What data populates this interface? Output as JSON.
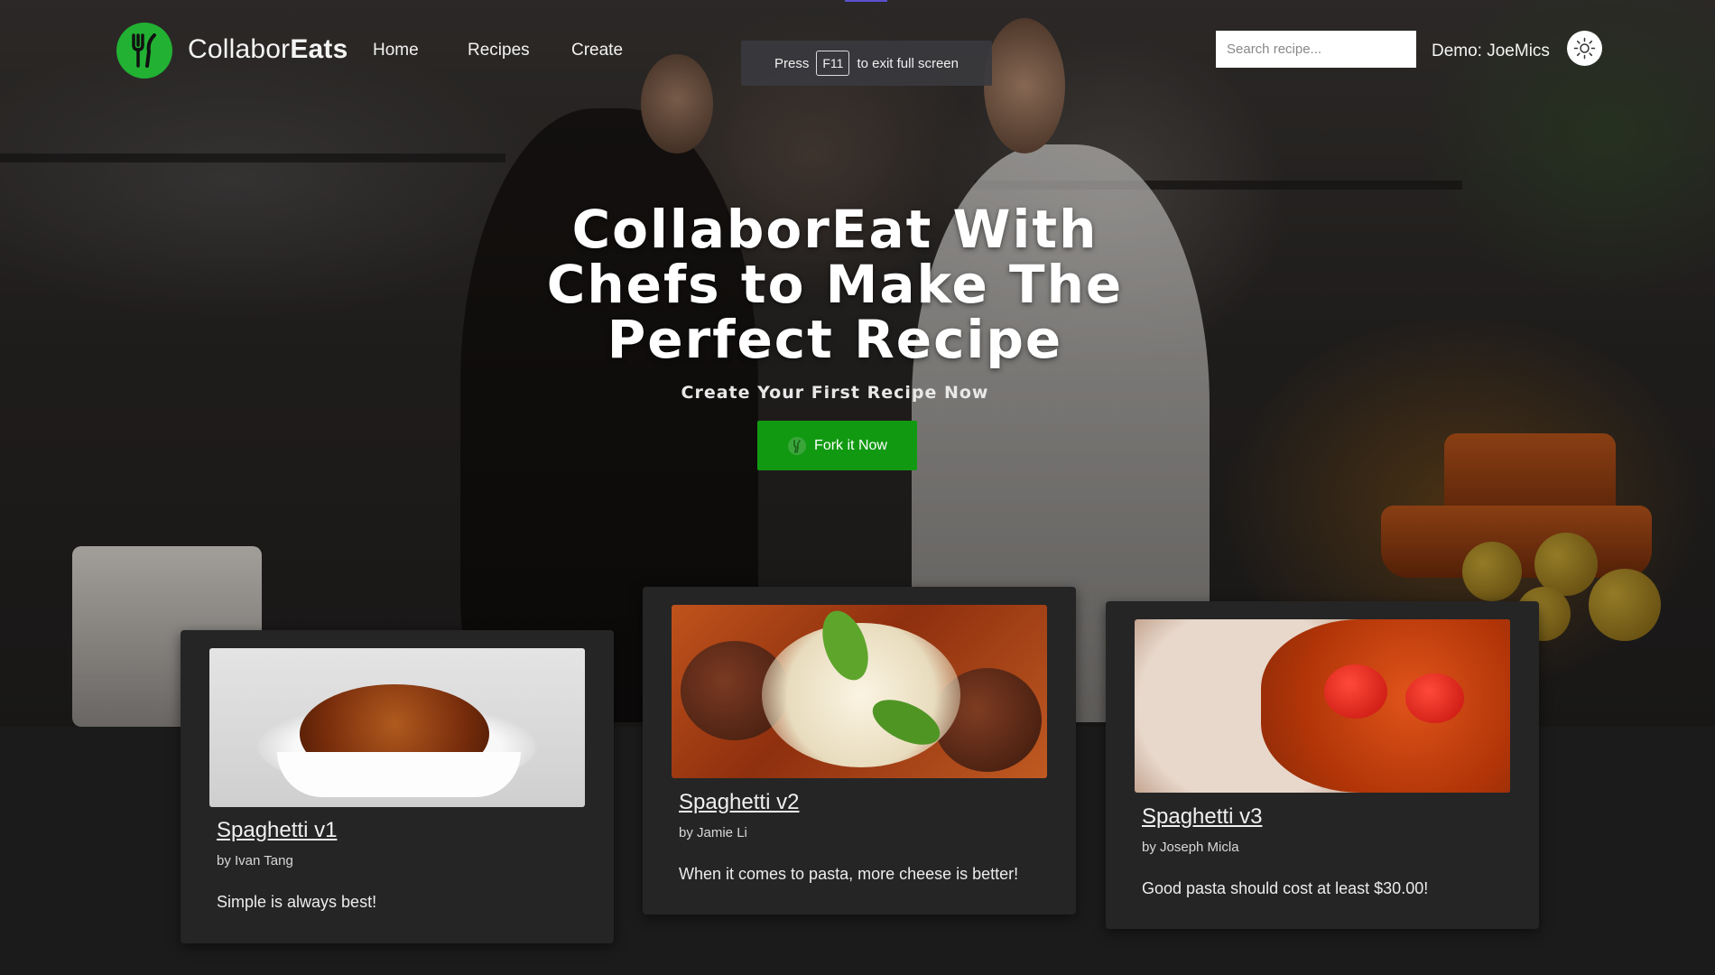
{
  "app": {
    "brand_light": "Collabor",
    "brand_bold": "Eats",
    "accent": "#22b133"
  },
  "nav": {
    "links": [
      {
        "label": "Home"
      },
      {
        "label": "Recipes"
      },
      {
        "label": "Create"
      }
    ],
    "search_placeholder": "Search recipe...",
    "user": "Demo: JoeMics",
    "theme_icon": "sun-icon"
  },
  "fullscreen_banner": {
    "press": "Press",
    "key": "F11",
    "rest": "to exit full screen"
  },
  "hero": {
    "title": "CollaborEat With Chefs to Make The Perfect Recipe",
    "subtitle": "Create Your First Recipe Now",
    "button_label": "Fork it Now"
  },
  "recipes": [
    {
      "title": "Spaghetti v1",
      "author": "by Ivan Tang",
      "description": "Simple is always best!"
    },
    {
      "title": "Spaghetti v2",
      "author": "by Jamie Li",
      "description": "When it comes to pasta, more cheese is better!"
    },
    {
      "title": "Spaghetti v3",
      "author": "by Joseph Micla",
      "description": "Good pasta should cost at least $30.00!"
    }
  ]
}
